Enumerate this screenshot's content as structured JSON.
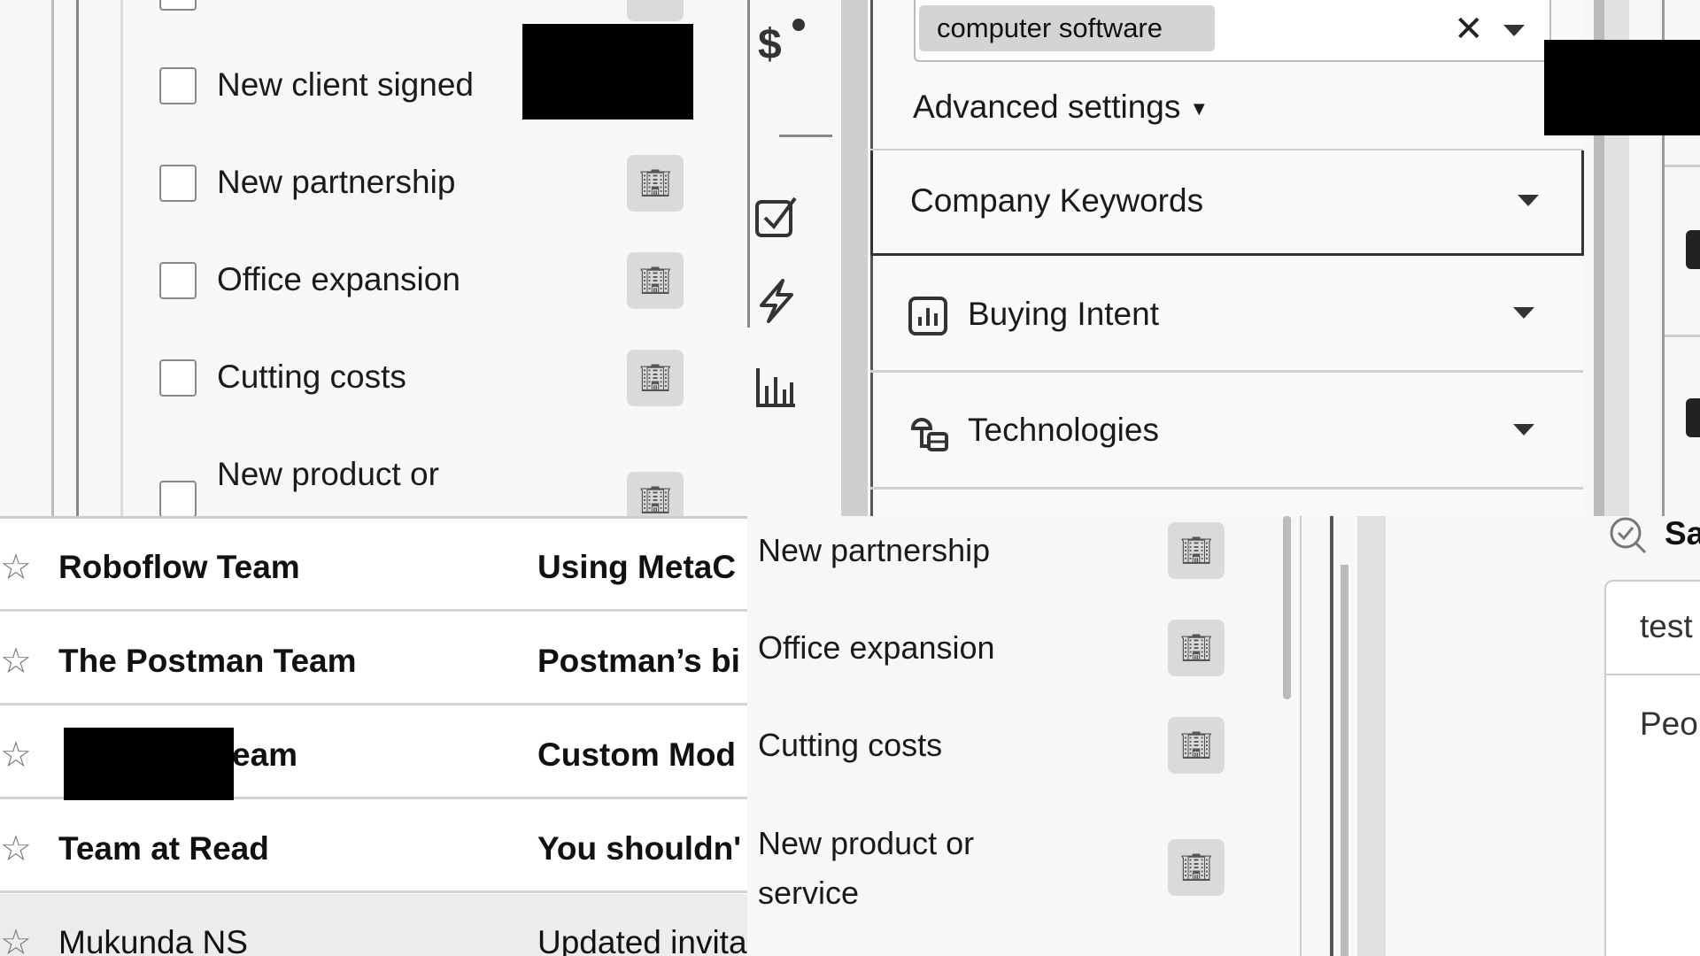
{
  "signals_list_top": {
    "items": [
      {
        "label": "New client signed",
        "checked": false
      },
      {
        "label": "New partnership",
        "checked": false
      },
      {
        "label": "Office expansion",
        "checked": false
      },
      {
        "label": "Cutting costs",
        "checked": false
      },
      {
        "label": "New product or",
        "checked": false
      }
    ],
    "item_icon": "building-icon"
  },
  "side_toolbar": {
    "icons": [
      "dollar-icon",
      "checkbox-icon",
      "bolt-icon",
      "bar-chart-icon"
    ]
  },
  "filters_panel": {
    "keyword_chip": "computer software",
    "advanced_settings": "Advanced settings",
    "sections": [
      {
        "label": "Company Keywords",
        "icon": ""
      },
      {
        "label": "Buying Intent",
        "icon": "bar-chart-icon"
      },
      {
        "label": "Technologies",
        "icon": "technologies-icon"
      }
    ]
  },
  "inbox": {
    "rows": [
      {
        "sender": "Roboflow Team",
        "subject": "Using MetaC",
        "unread": true
      },
      {
        "sender": "The Postman Team",
        "subject": "Postman’s bi",
        "unread": true
      },
      {
        "sender": "eam",
        "subject": "Custom Mod",
        "unread": true
      },
      {
        "sender": "Team at Read",
        "subject": "You shouldn'",
        "unread": true
      },
      {
        "sender": "Mukunda NS",
        "subject": "Updated invita",
        "unread": false
      }
    ]
  },
  "signals_list_bottom": {
    "items": [
      {
        "label": "New partnership"
      },
      {
        "label": "Office expansion"
      },
      {
        "label": "Cutting costs"
      },
      {
        "label": "New product or service"
      }
    ]
  },
  "right_panel": {
    "search_label": "Sa",
    "input_value": "test",
    "section_label": "Peo"
  }
}
